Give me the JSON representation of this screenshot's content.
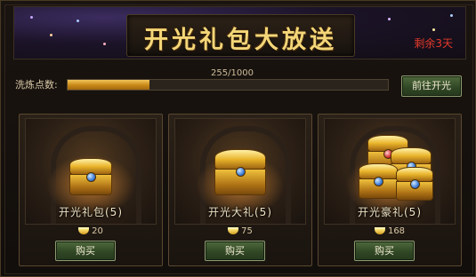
{
  "header": {
    "title": "开光礼包大放送",
    "remaining": "剩余3天"
  },
  "progress": {
    "label": "洗炼点数:",
    "current": 255,
    "max": 1000,
    "text": "255/1000",
    "open_button": "前往开光"
  },
  "packs": [
    {
      "name": "开光礼包(5)",
      "price": "20",
      "buy_label": "购买"
    },
    {
      "name": "开光大礼(5)",
      "price": "75",
      "buy_label": "购买"
    },
    {
      "name": "开光豪礼(5)",
      "price": "168",
      "buy_label": "购买"
    }
  ],
  "colors": {
    "accent_gold": "#f4d678",
    "bar_fill": "#e0a530",
    "alert_red": "#e23a2a",
    "button_green": "#3d5630"
  },
  "icons": {
    "price": "gold-ingot-icon",
    "pack": "treasure-chest-icon"
  }
}
